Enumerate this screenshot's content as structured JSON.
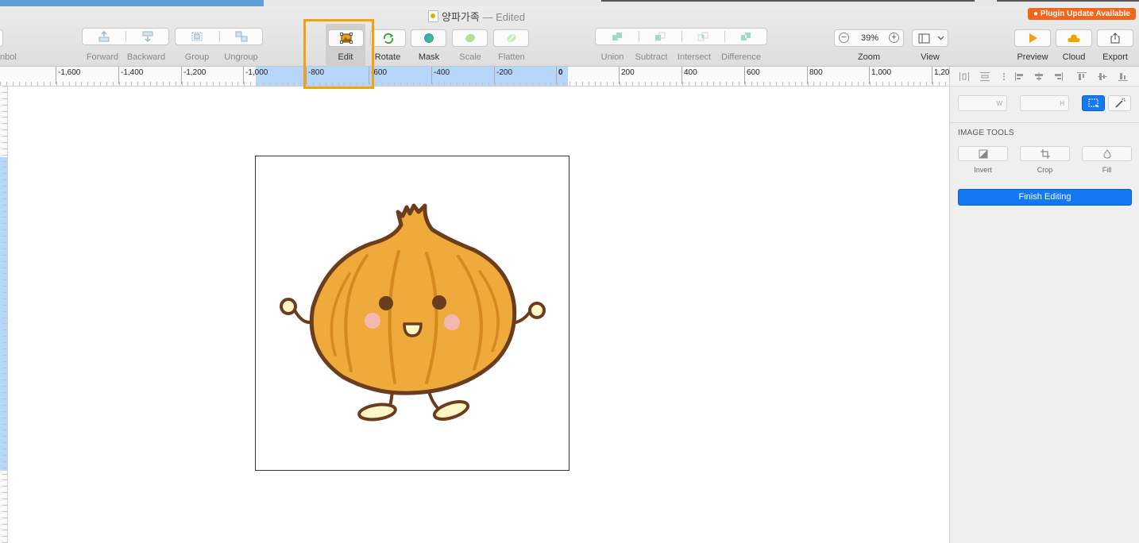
{
  "window": {
    "title": "양파가족",
    "edited_suffix": "— Edited",
    "plugin_badge": "● Plugin Update Available"
  },
  "toolbar": {
    "left_cut_label": "nbol",
    "items": [
      {
        "label": "Forward",
        "icon": "bring-forward-icon"
      },
      {
        "label": "Backward",
        "icon": "send-backward-icon"
      },
      {
        "label": "Group",
        "icon": "group-icon"
      },
      {
        "label": "Ungroup",
        "icon": "ungroup-icon"
      },
      {
        "label": "Edit",
        "icon": "edit-image-icon",
        "active": true
      },
      {
        "label": "Rotate",
        "icon": "rotate-icon"
      },
      {
        "label": "Mask",
        "icon": "mask-icon"
      },
      {
        "label": "Scale",
        "icon": "scale-icon"
      },
      {
        "label": "Flatten",
        "icon": "flatten-icon"
      },
      {
        "label": "Union",
        "icon": "union-icon"
      },
      {
        "label": "Subtract",
        "icon": "subtract-icon"
      },
      {
        "label": "Intersect",
        "icon": "intersect-icon"
      },
      {
        "label": "Difference",
        "icon": "difference-icon"
      }
    ],
    "zoom": {
      "label": "Zoom",
      "value": "39%",
      "minus": "−",
      "plus": "+"
    },
    "view": {
      "label": "View"
    },
    "preview": {
      "label": "Preview",
      "icon": "play-icon"
    },
    "cloud": {
      "label": "Cloud",
      "icon": "cloud-icon"
    },
    "export": {
      "label": "Export",
      "icon": "share-icon"
    }
  },
  "ruler": {
    "labels": [
      "-1,600",
      "-1,400",
      "-1,200",
      "-1,000",
      "-800",
      "-600",
      "-400",
      "-200",
      "0",
      "200",
      "400",
      "600",
      "800",
      "1,000",
      "1,20"
    ]
  },
  "inspector": {
    "width_placeholder": "W",
    "height_placeholder": "H",
    "section_title": "IMAGE TOOLS",
    "tools": [
      {
        "label": "Invert",
        "icon": "invert-icon"
      },
      {
        "label": "Crop",
        "icon": "crop-icon"
      },
      {
        "label": "Fill",
        "icon": "fill-drop-icon"
      }
    ],
    "finish_button": "Finish Editing"
  },
  "colors": {
    "accent_blue": "#1578f3",
    "highlight_orange": "#f2a20c",
    "badge_orange": "#f0671b",
    "onion_fill": "#eeaa3b",
    "onion_outline": "#6b3d1c"
  }
}
